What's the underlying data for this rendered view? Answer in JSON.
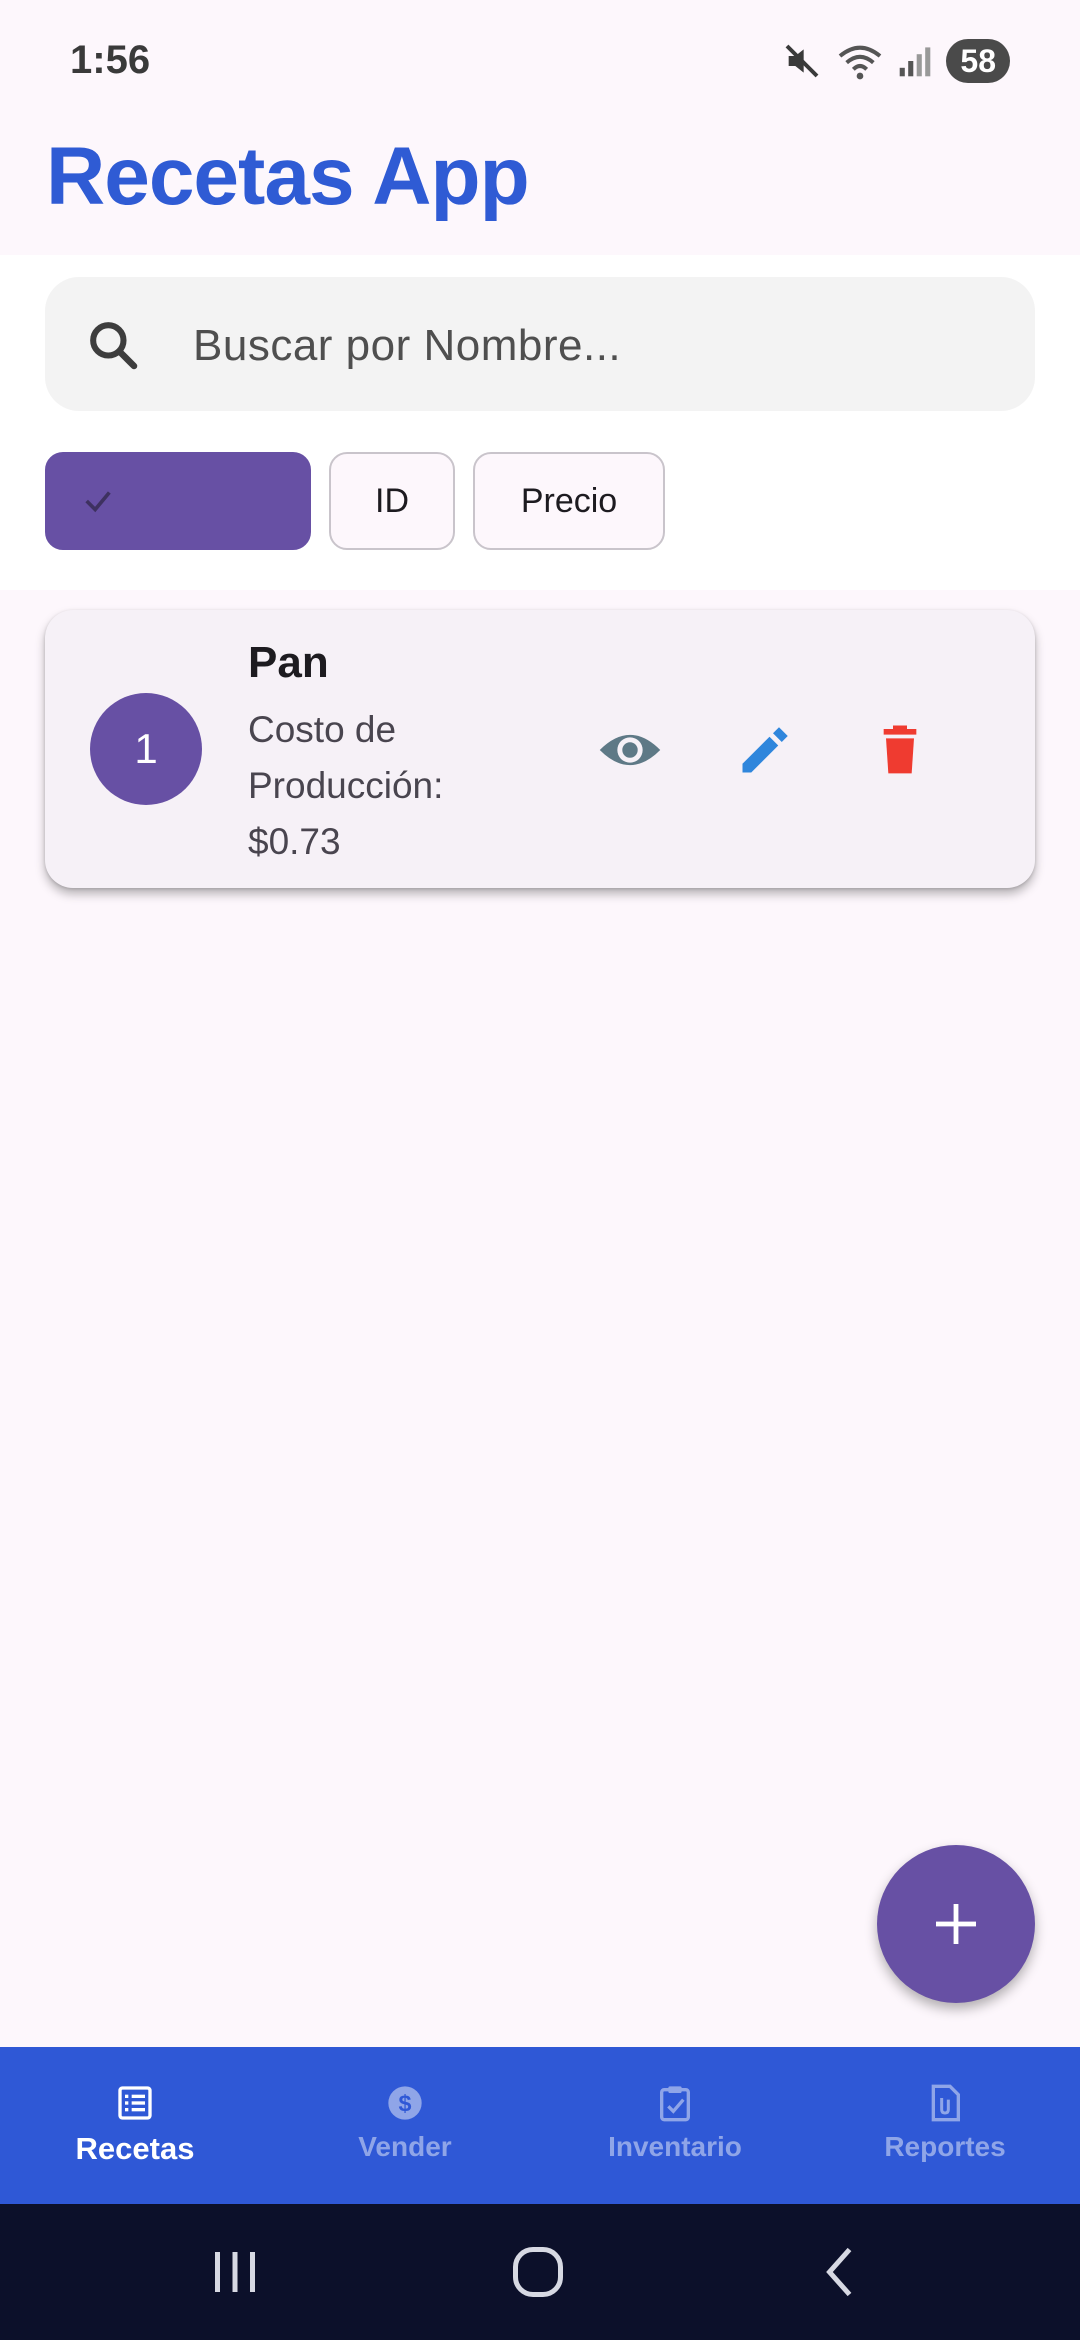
{
  "status_bar": {
    "time": "1:56",
    "battery": "58"
  },
  "app_bar": {
    "title": "Recetas App"
  },
  "search": {
    "placeholder": "Buscar por Nombre..."
  },
  "filters": {
    "chips": [
      {
        "label": "",
        "selected": true
      },
      {
        "label": "ID",
        "selected": false
      },
      {
        "label": "Precio",
        "selected": false
      }
    ]
  },
  "recipes": [
    {
      "id": "1",
      "name": "Pan",
      "cost_label": "Costo de Producción:",
      "cost_value": "$0.73"
    }
  ],
  "bottom_nav": {
    "items": [
      {
        "label": "Recetas",
        "icon": "list-icon",
        "active": true
      },
      {
        "label": "Vender",
        "icon": "dollar-icon",
        "active": false
      },
      {
        "label": "Inventario",
        "icon": "clipboard-check-icon",
        "active": false
      },
      {
        "label": "Reportes",
        "icon": "document-icon",
        "active": false
      }
    ]
  },
  "colors": {
    "accent": "#6750a4",
    "title": "#2f5bd4",
    "nav_bg": "#2f58d6",
    "view": "#5e7986",
    "edit": "#2f86dc",
    "delete": "#ef3b30"
  }
}
